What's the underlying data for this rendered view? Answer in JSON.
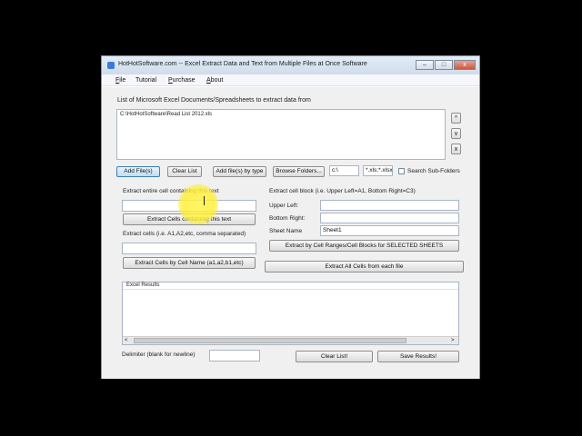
{
  "window": {
    "title": "HotHotSoftware.com -- Excel Extract Data and Text from Multiple Files at Once Software",
    "controls": {
      "minimize": "–",
      "maximize": "□",
      "close": "x"
    }
  },
  "menu": {
    "items": [
      {
        "accel": "F",
        "rest": "ile"
      },
      {
        "accel": "",
        "rest": "Tutorial"
      },
      {
        "accel": "P",
        "rest": "urchase"
      },
      {
        "accel": "A",
        "rest": "bout"
      }
    ]
  },
  "files": {
    "heading": "List of Microsoft Excel Documents/Spreadsheets to extract data from",
    "entries": [
      "C:\\HotHotSoftware\\Read List 2012.xls"
    ],
    "up_label": "^",
    "down_label": "v",
    "remove_label": "x"
  },
  "toolbar": {
    "add_files": "Add File(s)",
    "clear_list": "Clear List",
    "add_by_type": "Add file(s) by type",
    "browse_folders": "Browse Folders...",
    "folder_value": "c:\\",
    "pattern_value": "*.xls;*.xlsx",
    "search_subfolders": "Search Sub-Folders"
  },
  "left": {
    "contain_label": "Extract entire cell containing this text",
    "contain_value": "",
    "contain_button": "Extract Cells containing this text",
    "cells_label": "Extract cells (i.e. A1,A2,etc, comma separated)",
    "cells_value": "",
    "cells_button": "Extract Cells by Cell Name (a1,a2,b1,etc)"
  },
  "right": {
    "block_label": "Extract cell block (i.e. Upper Left=A1, Bottom Right=C3)",
    "upper_left_label": "Upper Left:",
    "upper_left_value": "",
    "bottom_right_label": "Bottom Right:",
    "bottom_right_value": "",
    "sheet_name_label": "Sheet Name",
    "sheet_name_value": "Sheet1",
    "ranges_button": "Extract by Cell Ranges/Cell Blocks for SELECTED SHEETS",
    "all_button": "Extract All Cells from each file"
  },
  "results": {
    "header": "Excel Results",
    "scroll_left": "<",
    "scroll_right": ">"
  },
  "footer": {
    "delimiter_label": "Delimiter (blank for newline)",
    "delimiter_value": "",
    "clear_button": "Clear List!",
    "save_button": "Save Results!"
  }
}
